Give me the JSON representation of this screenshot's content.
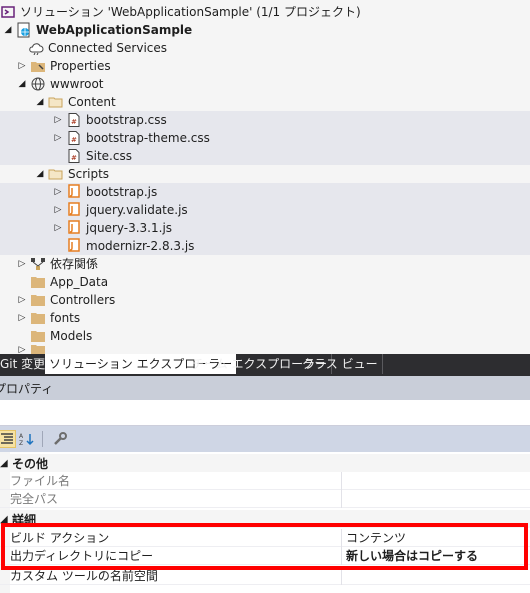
{
  "solution_explorer": {
    "solution_title": "ソリューション 'WebApplicationSample' (1/1 プロジェクト)",
    "project": "WebApplicationSample",
    "items": {
      "connected_services": "Connected Services",
      "properties": "Properties",
      "wwwroot": "wwwroot",
      "content": "Content",
      "bootstrap_css": "bootstrap.css",
      "bootstrap_theme_css": "bootstrap-theme.css",
      "site_css": "Site.css",
      "scripts": "Scripts",
      "bootstrap_js": "bootstrap.js",
      "jquery_validate_js": "jquery.validate.js",
      "jquery_js": "jquery-3.3.1.js",
      "modernizr_js": "modernizr-2.8.3.js",
      "dependencies": "依存関係",
      "app_data": "App_Data",
      "controllers": "Controllers",
      "fonts": "fonts",
      "models": "Models"
    }
  },
  "tabs": {
    "git": "Git 変更",
    "solution_explorer": "ソリューション エクスプローラー",
    "team_explorer": "チーム エクスプローラー",
    "class_view": "クラス ビュー"
  },
  "properties_panel": {
    "title": "プロパティ",
    "categories": {
      "misc": "その他",
      "detail": "詳細"
    },
    "rows": {
      "file_name": "ファイル名",
      "full_path": "完全パス",
      "build_action": "ビルド アクション",
      "build_action_value": "コンテンツ",
      "copy_to_output": "出力ディレクトリにコピー",
      "copy_to_output_value": "新しい場合はコピーする",
      "custom_tool_ns": "カスタム ツールの名前空間"
    }
  },
  "colors": {
    "highlight": "#ff0000",
    "tab_bar": "#2d2d30",
    "selection_bg": "#e6e7ed"
  }
}
